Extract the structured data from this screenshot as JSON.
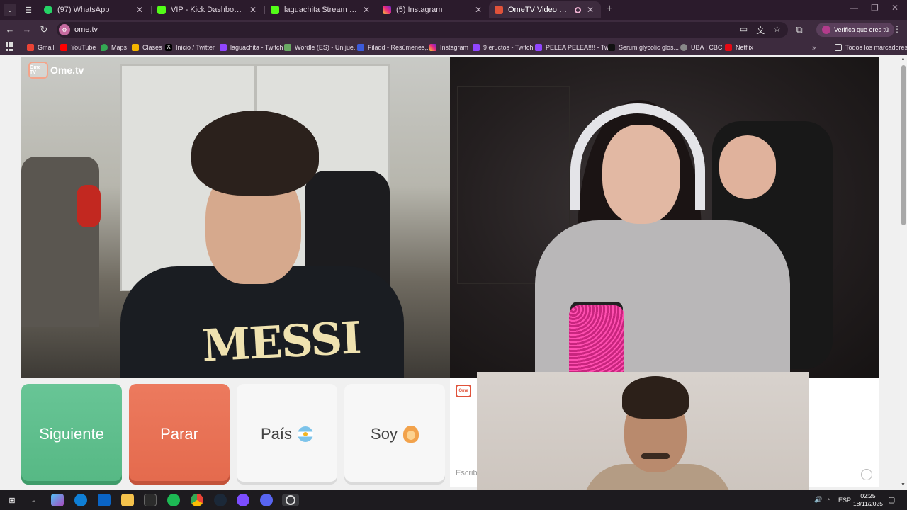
{
  "browser": {
    "tabs": [
      {
        "title": "(97) WhatsApp",
        "favicon": "whatsapp-icon",
        "color": "#25d366"
      },
      {
        "title": "VIP - Kick Dashboard",
        "favicon": "kick-icon",
        "color": "#53fc18"
      },
      {
        "title": "laguachita Stream - Watch Live",
        "favicon": "kick-icon",
        "color": "#53fc18"
      },
      {
        "title": "(5) Instagram",
        "favicon": "instagram-icon",
        "color": "#e1306c"
      },
      {
        "title": "OmeTV Video Chat — Ome",
        "favicon": "ometv-icon",
        "color": "#e0523a",
        "active": true
      }
    ],
    "url": "ome.tv",
    "verify_label": "Verifica que eres tú",
    "bookmarks": [
      {
        "label": "Gmail",
        "icon": "gmail-icon",
        "color": "#ea4335"
      },
      {
        "label": "YouTube",
        "icon": "youtube-icon",
        "color": "#ff0000"
      },
      {
        "label": "Maps",
        "icon": "maps-icon",
        "color": "#34a853"
      },
      {
        "label": "Clases",
        "icon": "classroom-icon",
        "color": "#f4b400"
      },
      {
        "label": "Inicio / Twitter",
        "icon": "x-icon",
        "color": "#000000"
      },
      {
        "label": "laguachita - Twitch",
        "icon": "twitch-icon",
        "color": "#9146ff"
      },
      {
        "label": "Wordle (ES) - Un jue...",
        "icon": "wordle-icon",
        "color": "#6aaa64"
      },
      {
        "label": "Filadd - Resúmenes,...",
        "icon": "filadd-icon",
        "color": "#3b5bdb"
      },
      {
        "label": "Instagram",
        "icon": "instagram-icon",
        "color": "#e1306c"
      },
      {
        "label": "9 eructos - Twitch",
        "icon": "twitch-icon",
        "color": "#9146ff"
      },
      {
        "label": "PELEA PELEA!!!! - Tw...",
        "icon": "twitch-icon",
        "color": "#9146ff"
      },
      {
        "label": "Serum glycolic glos...",
        "icon": "tiktok-icon",
        "color": "#000000"
      },
      {
        "label": "UBA | CBC",
        "icon": "globe-icon",
        "color": "#888888"
      },
      {
        "label": "Netflix",
        "icon": "netflix-icon",
        "color": "#e50914"
      }
    ],
    "all_bookmarks_label": "Todos los marcadores"
  },
  "page": {
    "logo_text": "Ome.tv",
    "logo_badge": "Ome TV",
    "video_left_shirt_text": "MESSI",
    "buttons": {
      "next": "Siguiente",
      "stop": "Parar",
      "country": "País",
      "me": "Soy"
    },
    "chat_placeholder": "Escribe"
  },
  "taskbar": {
    "language": "ESP",
    "time": "02:25",
    "date": "18/11/2025"
  }
}
